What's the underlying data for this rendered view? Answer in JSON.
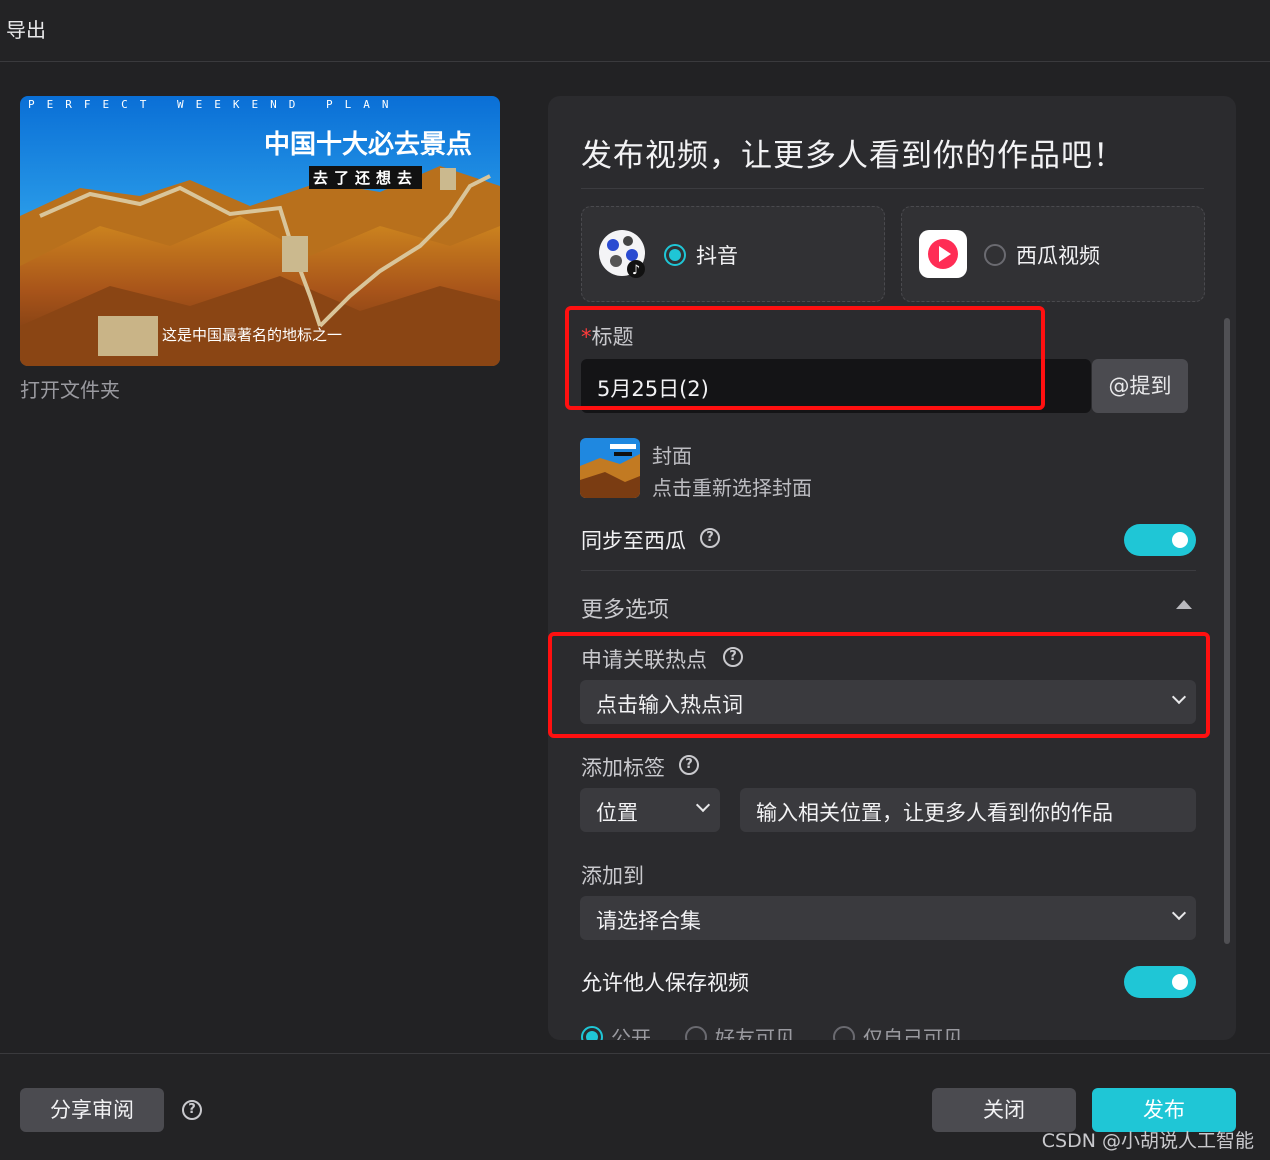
{
  "window": {
    "title": "导出"
  },
  "preview": {
    "top_text": "PERFECT WEEKEND PLAN",
    "main_title": "中国十大必去景点",
    "subtitle": "去了还想去",
    "caption": "这是中国最著名的地标之一",
    "open_folder": "打开文件夹"
  },
  "publish": {
    "heading": "发布视频，让更多人看到你的作品吧！",
    "platforms": [
      {
        "name": "抖音",
        "selected": true,
        "icon": "douyin-logo-icon"
      },
      {
        "name": "西瓜视频",
        "selected": false,
        "icon": "xigua-logo-icon"
      }
    ],
    "title_field": {
      "required_mark": "*",
      "label": "标题",
      "value": "5月25日(2)",
      "mention_label": "@提到"
    },
    "cover": {
      "label": "封面",
      "hint": "点击重新选择封面"
    },
    "sync_xigua": {
      "label": "同步至西瓜",
      "enabled": true
    },
    "more_options": {
      "label": "更多选项",
      "expanded": true
    },
    "hotspot": {
      "label": "申请关联热点",
      "placeholder": "点击输入热点词"
    },
    "tags": {
      "label": "添加标签",
      "type_value": "位置",
      "placeholder": "输入相关位置，让更多人看到你的作品"
    },
    "add_to": {
      "label": "添加到",
      "placeholder": "请选择合集"
    },
    "allow_save": {
      "label": "允许他人保存视频",
      "enabled": true
    },
    "visibility": {
      "options": [
        "公开",
        "好友可见",
        "仅自己可见"
      ],
      "selected": "公开"
    }
  },
  "footer": {
    "share_review": "分享审阅",
    "close": "关闭",
    "publish": "发布",
    "watermark": "CSDN @小胡说人工智能"
  },
  "colors": {
    "accent": "#1fc6d6",
    "highlight_box": "#ff1010",
    "background": "#222224",
    "panel": "#2b2b2e"
  }
}
